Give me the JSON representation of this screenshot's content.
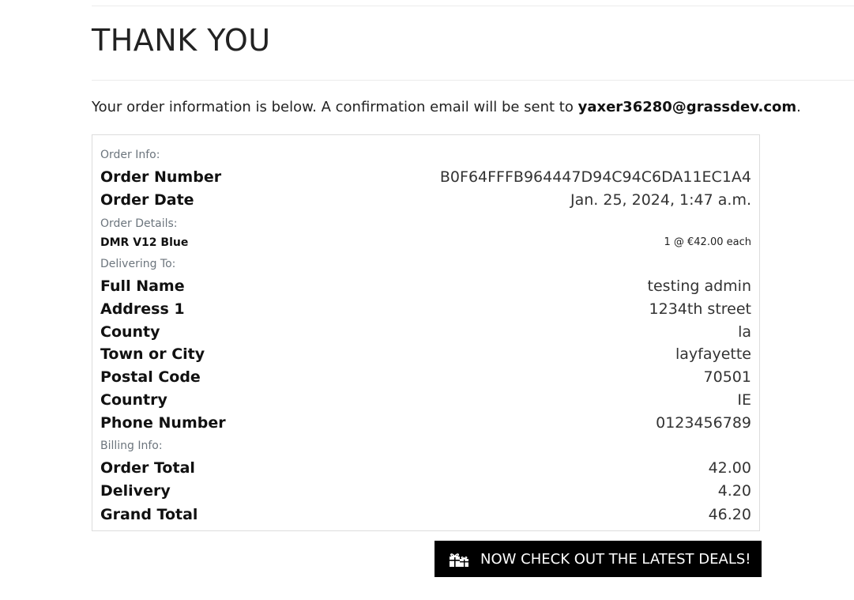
{
  "page": {
    "title": "THANK YOU",
    "intro_text": "Your order information is below. A confirmation email will be sent to ",
    "email": "yaxer36280@grassdev.com",
    "intro_end": "."
  },
  "order_info": {
    "section_label": "Order Info:",
    "order_number_label": "Order Number",
    "order_number": "B0F64FFFB964447D94C94C6DA11EC1A4",
    "order_date_label": "Order Date",
    "order_date": "Jan. 25, 2024, 1:47 a.m."
  },
  "order_details": {
    "section_label": "Order Details:",
    "item_name": "DMR V12 Blue",
    "item_qty_price": "1 @ €42.00 each"
  },
  "delivering_to": {
    "section_label": "Delivering To:",
    "rows": [
      {
        "label": "Full Name",
        "value": "testing admin"
      },
      {
        "label": "Address 1",
        "value": "1234th street"
      },
      {
        "label": "County",
        "value": "la"
      },
      {
        "label": "Town or City",
        "value": "layfayette"
      },
      {
        "label": "Postal Code",
        "value": "70501"
      },
      {
        "label": "Country",
        "value": "IE"
      },
      {
        "label": "Phone Number",
        "value": "0123456789"
      }
    ]
  },
  "billing_info": {
    "section_label": "Billing Info:",
    "rows": [
      {
        "label": "Order Total",
        "value": "42.00"
      },
      {
        "label": "Delivery",
        "value": "4.20"
      },
      {
        "label": "Grand Total",
        "value": "46.20"
      }
    ]
  },
  "deals_button": {
    "label": "NOW CHECK OUT THE LATEST DEALS!",
    "icon": "gifts-icon"
  }
}
